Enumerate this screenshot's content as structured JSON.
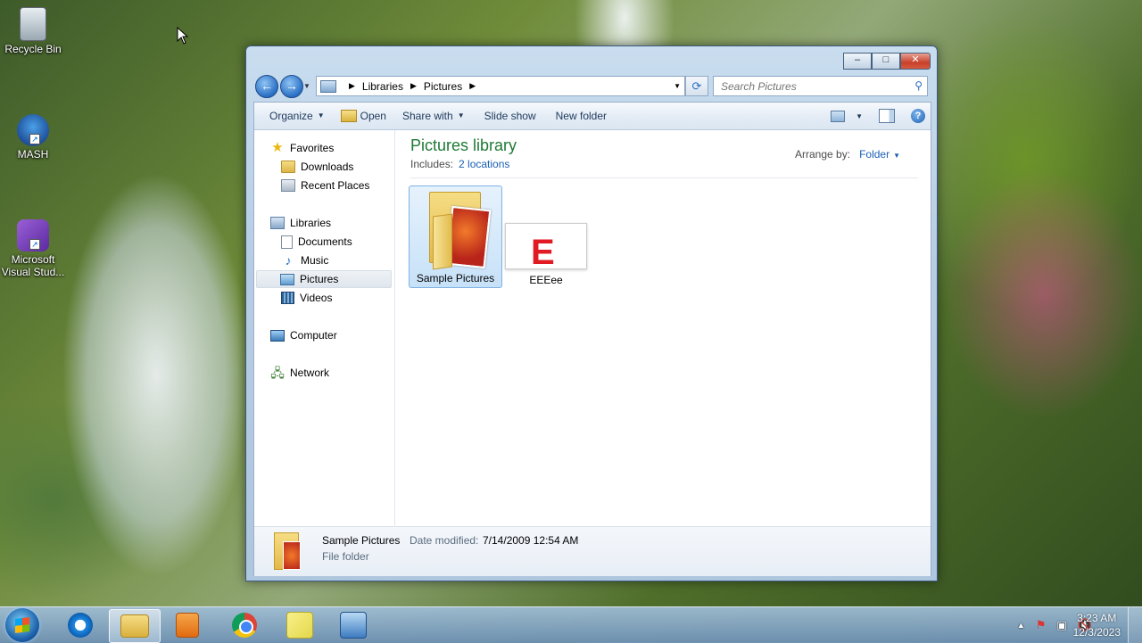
{
  "desktop": {
    "icons": [
      {
        "label": "Recycle Bin",
        "icon": "recycle-bin-icon"
      },
      {
        "label": "MASH",
        "icon": "mash-app-icon"
      },
      {
        "label": "Microsoft Visual Stud...",
        "icon": "visual-studio-icon"
      }
    ]
  },
  "window": {
    "title_buttons": {
      "minimize": "–",
      "maximize": "□",
      "close": "✕"
    },
    "address": {
      "segments": [
        "Libraries",
        "Pictures"
      ]
    },
    "search": {
      "placeholder": "Search Pictures"
    },
    "toolbar": {
      "organize": "Organize",
      "open": "Open",
      "share_with": "Share with",
      "slide_show": "Slide show",
      "new_folder": "New folder"
    },
    "nav_pane": {
      "favorites": "Favorites",
      "downloads": "Downloads",
      "recent_places": "Recent Places",
      "libraries": "Libraries",
      "documents": "Documents",
      "music": "Music",
      "pictures": "Pictures",
      "videos": "Videos",
      "computer": "Computer",
      "network": "Network"
    },
    "content": {
      "title": "Pictures library",
      "includes_label": "Includes:",
      "includes_link": "2 locations",
      "arrange_label": "Arrange by:",
      "arrange_value": "Folder",
      "items": [
        {
          "name": "Sample Pictures",
          "type": "folder"
        },
        {
          "name": "EEEee",
          "type": "image"
        }
      ],
      "thumb_letter": "E"
    },
    "details": {
      "name": "Sample Pictures",
      "date_label": "Date modified:",
      "date_value": "7/14/2009 12:54 AM",
      "type": "File folder"
    }
  },
  "taskbar": {
    "apps": [
      "internet-explorer-icon",
      "windows-explorer-icon",
      "media-player-icon",
      "chrome-icon",
      "sticky-notes-icon",
      "remote-desktop-icon"
    ],
    "active_app": "windows-explorer-icon",
    "tray_expand": "▲",
    "clock_time": "3:23 AM",
    "clock_date": "12/3/2023"
  }
}
